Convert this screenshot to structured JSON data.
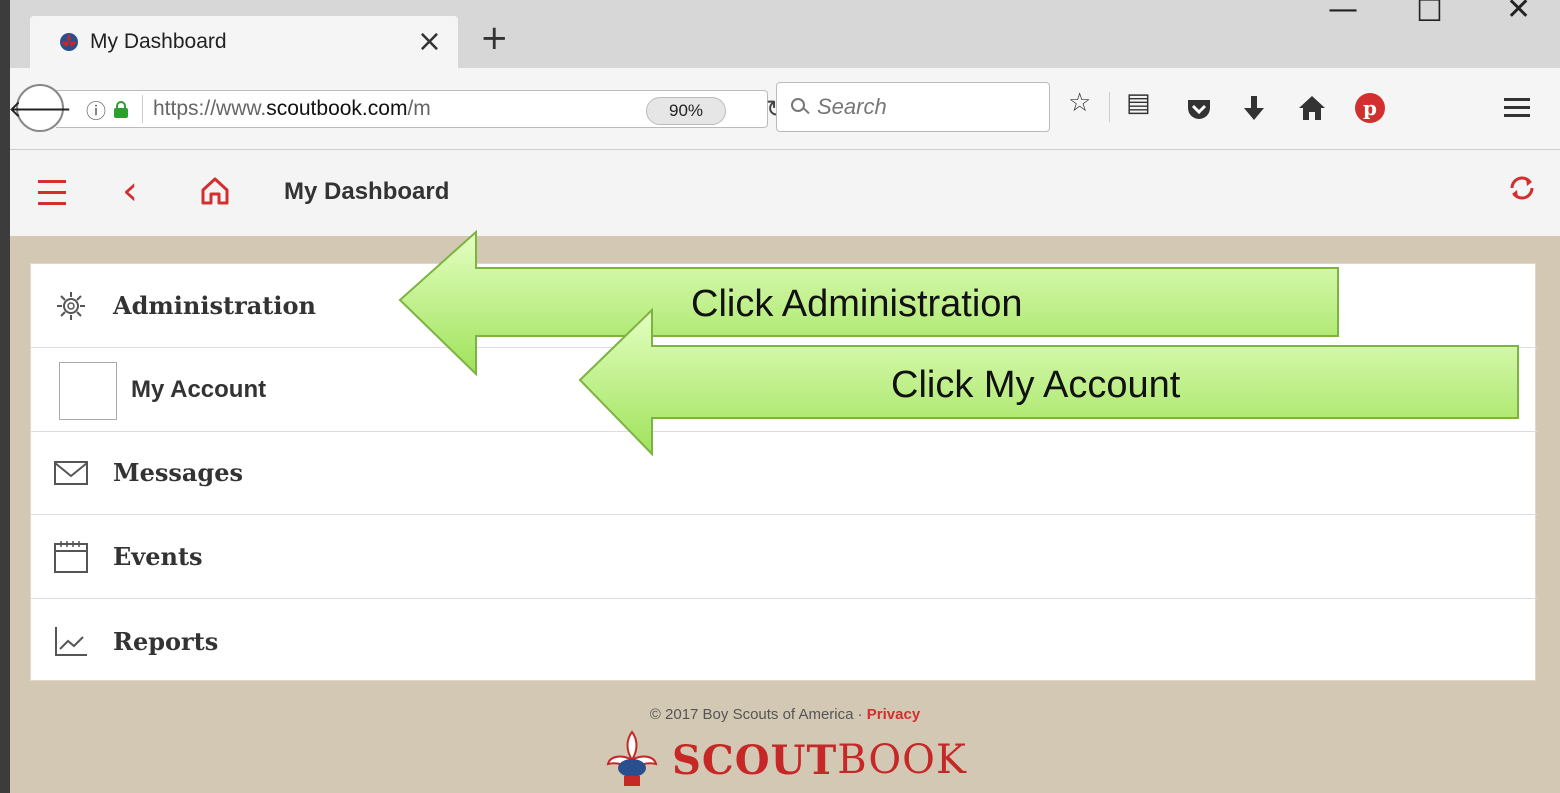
{
  "browser": {
    "tab_title": "My Dashboard",
    "tab_close_glyph": "×",
    "new_tab_glyph": "+",
    "window_controls": [
      "—",
      "☐",
      "✕"
    ],
    "url_prefix": "https://www.",
    "url_domain": "scoutbook.com",
    "url_suffix": "/m",
    "zoom": "90%",
    "search_placeholder": "Search",
    "toolbar_icons": [
      "star-icon",
      "reader-icon",
      "pocket-icon",
      "download-icon",
      "home-icon",
      "pinterest-icon"
    ]
  },
  "app": {
    "title": "My Dashboard",
    "back_glyph": "‹",
    "accent_color": "#d32f2f"
  },
  "menu": {
    "items": [
      {
        "label": "Administration",
        "icon": "gear-icon"
      },
      {
        "label": "My Account",
        "icon": "blank-box"
      },
      {
        "label": "Messages",
        "icon": "envelope-icon"
      },
      {
        "label": "Events",
        "icon": "calendar-icon"
      },
      {
        "label": "Reports",
        "icon": "chart-icon"
      }
    ]
  },
  "footer": {
    "copyright": "© 2017 Boy Scouts of America · ",
    "privacy": "Privacy",
    "logo_scout": "SCOUT",
    "logo_book": "BOOK"
  },
  "callouts": {
    "administration": "Click Administration",
    "my_account": "Click My Account",
    "fill_color": "#b6f27a"
  }
}
